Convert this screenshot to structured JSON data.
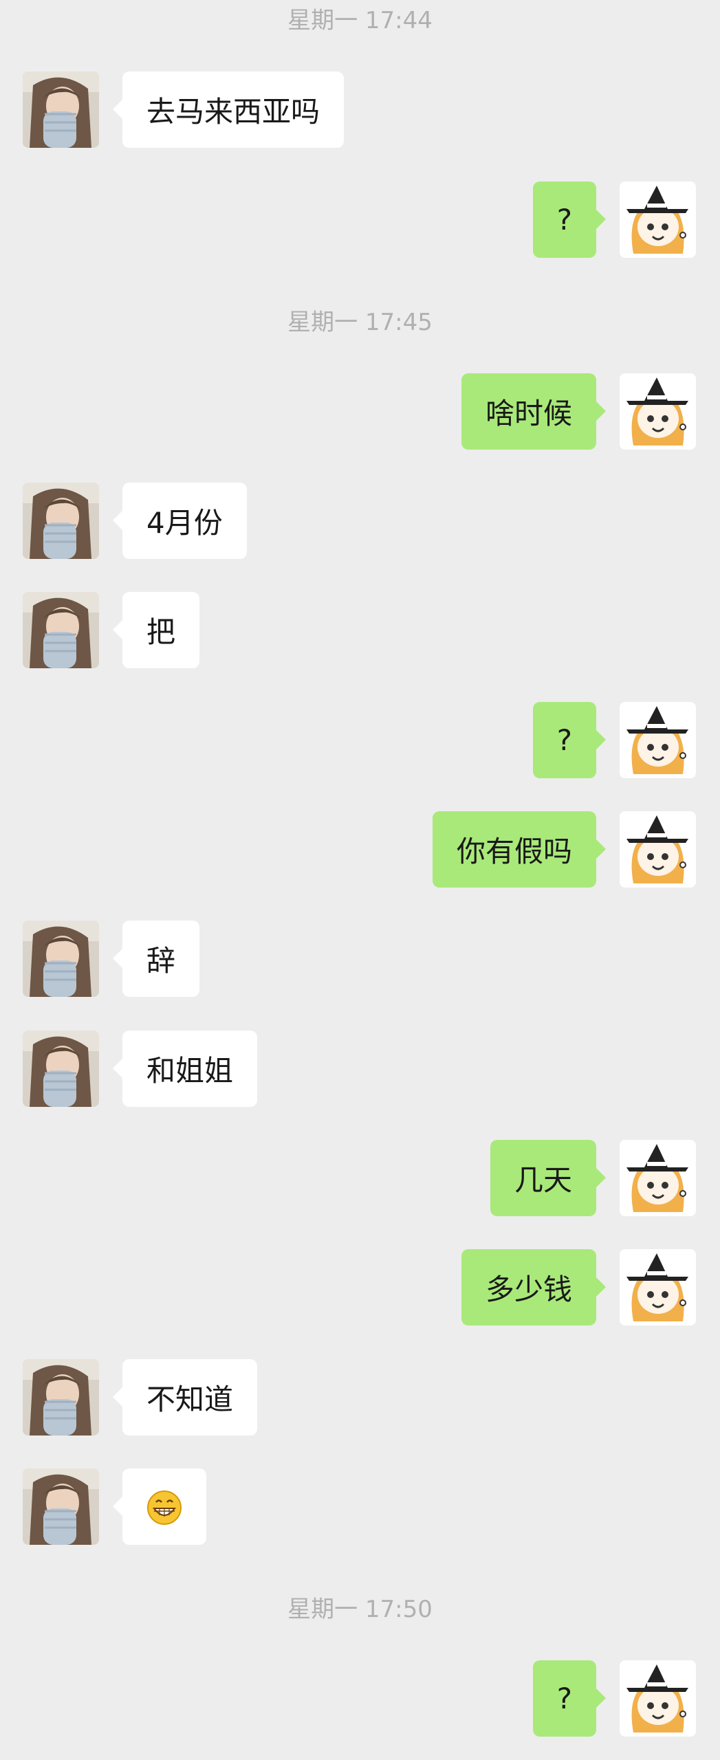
{
  "colors": {
    "background": "#ededed",
    "incoming_bubble": "#ffffff",
    "outgoing_bubble": "#a9e97a",
    "timestamp_text": "#b0b0b0",
    "message_text": "#191919"
  },
  "timestamps": [
    "星期一 17:44",
    "星期一 17:45",
    "星期一 17:50"
  ],
  "messages": [
    {
      "side": "in",
      "text": "去马来西亚吗"
    },
    {
      "side": "out",
      "text": "?"
    },
    {
      "side": "out",
      "text": "啥时候"
    },
    {
      "side": "in",
      "text": "4月份"
    },
    {
      "side": "in",
      "text": "把"
    },
    {
      "side": "out",
      "text": "?"
    },
    {
      "side": "out",
      "text": "你有假吗"
    },
    {
      "side": "in",
      "text": "辞"
    },
    {
      "side": "in",
      "text": "和姐姐"
    },
    {
      "side": "out",
      "text": "几天"
    },
    {
      "side": "out",
      "text": "多少钱"
    },
    {
      "side": "in",
      "text": "不知道"
    },
    {
      "side": "in",
      "emoji": "grinning-face-emoji"
    },
    {
      "side": "out",
      "text": "?"
    }
  ]
}
